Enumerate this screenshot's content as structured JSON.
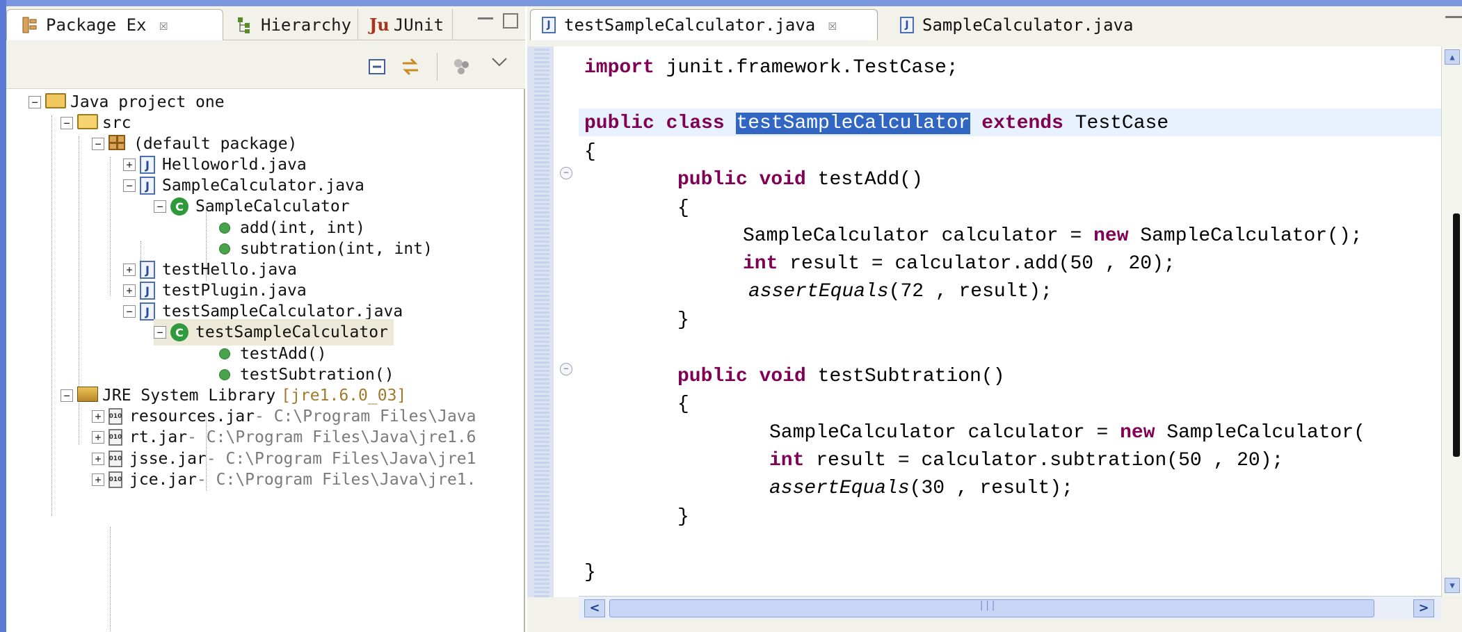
{
  "left_view": {
    "tabs": [
      {
        "label": "Package Ex",
        "close": "☒"
      },
      {
        "label": "Hierarchy"
      },
      {
        "label": "JUnit",
        "icon_text": "Ju"
      }
    ],
    "tree": {
      "project": "Java project one",
      "src": "src",
      "default_package": "(default package)",
      "helloworld": "Helloworld.java",
      "samplecalc_file": "SampleCalculator.java",
      "samplecalc_class": "SampleCalculator",
      "method_add": "add(int, int)",
      "method_sub": "subtration(int, int)",
      "testhello": "testHello.java",
      "testplugin": "testPlugin.java",
      "testsample_file": "testSampleCalculator.java",
      "testsample_class": "testSampleCalculator",
      "method_testadd": "testAdd()",
      "method_testsub": "testSubtration()",
      "jre": "JRE System Library",
      "jre_version": "[jre1.6.0_03]",
      "jars": [
        {
          "name": "resources.jar",
          "path": " - C:\\Program Files\\Java"
        },
        {
          "name": "rt.jar",
          "path": " - C:\\Program Files\\Java\\jre1.6"
        },
        {
          "name": "jsse.jar",
          "path": " - C:\\Program Files\\Java\\jre1"
        },
        {
          "name": "jce.jar",
          "path": " - C:\\Program Files\\Java\\jre1."
        }
      ]
    }
  },
  "editor": {
    "tabs": [
      {
        "label": "testSampleCalculator.java",
        "close": "☒"
      },
      {
        "label": "SampleCalculator.java"
      }
    ],
    "code": {
      "l1_kw": "import",
      "l1_rest": " junit.framework.TestCase;",
      "l2_kw1": "public class ",
      "l2_name": "testSampleCalculator",
      "l2_kw2": " extends",
      "l2_rest": " TestCase",
      "l3": "{",
      "l4_kw": "public void",
      "l4_rest": " testAdd()",
      "l5": "{",
      "l6_a": "SampleCalculator calculator = ",
      "l6_kw": "new",
      "l6_b": " SampleCalculator();",
      "l7_kw": "int",
      "l7_rest": " result = calculator.add(50 , 20);",
      "l8_it": "assertEquals",
      "l8_rest": "(72 , result);",
      "l9": "}",
      "l10_kw": "public void",
      "l10_rest": " testSubtration()",
      "l11": "{",
      "l12_a": "SampleCalculator calculator = ",
      "l12_kw": "new",
      "l12_b": " SampleCalculator(",
      "l13_kw": "int",
      "l13_rest": " result = calculator.subtration(50 , 20);",
      "l14_it": "assertEquals",
      "l14_rest": "(30 , result);",
      "l15": "}",
      "l16": "}"
    }
  }
}
